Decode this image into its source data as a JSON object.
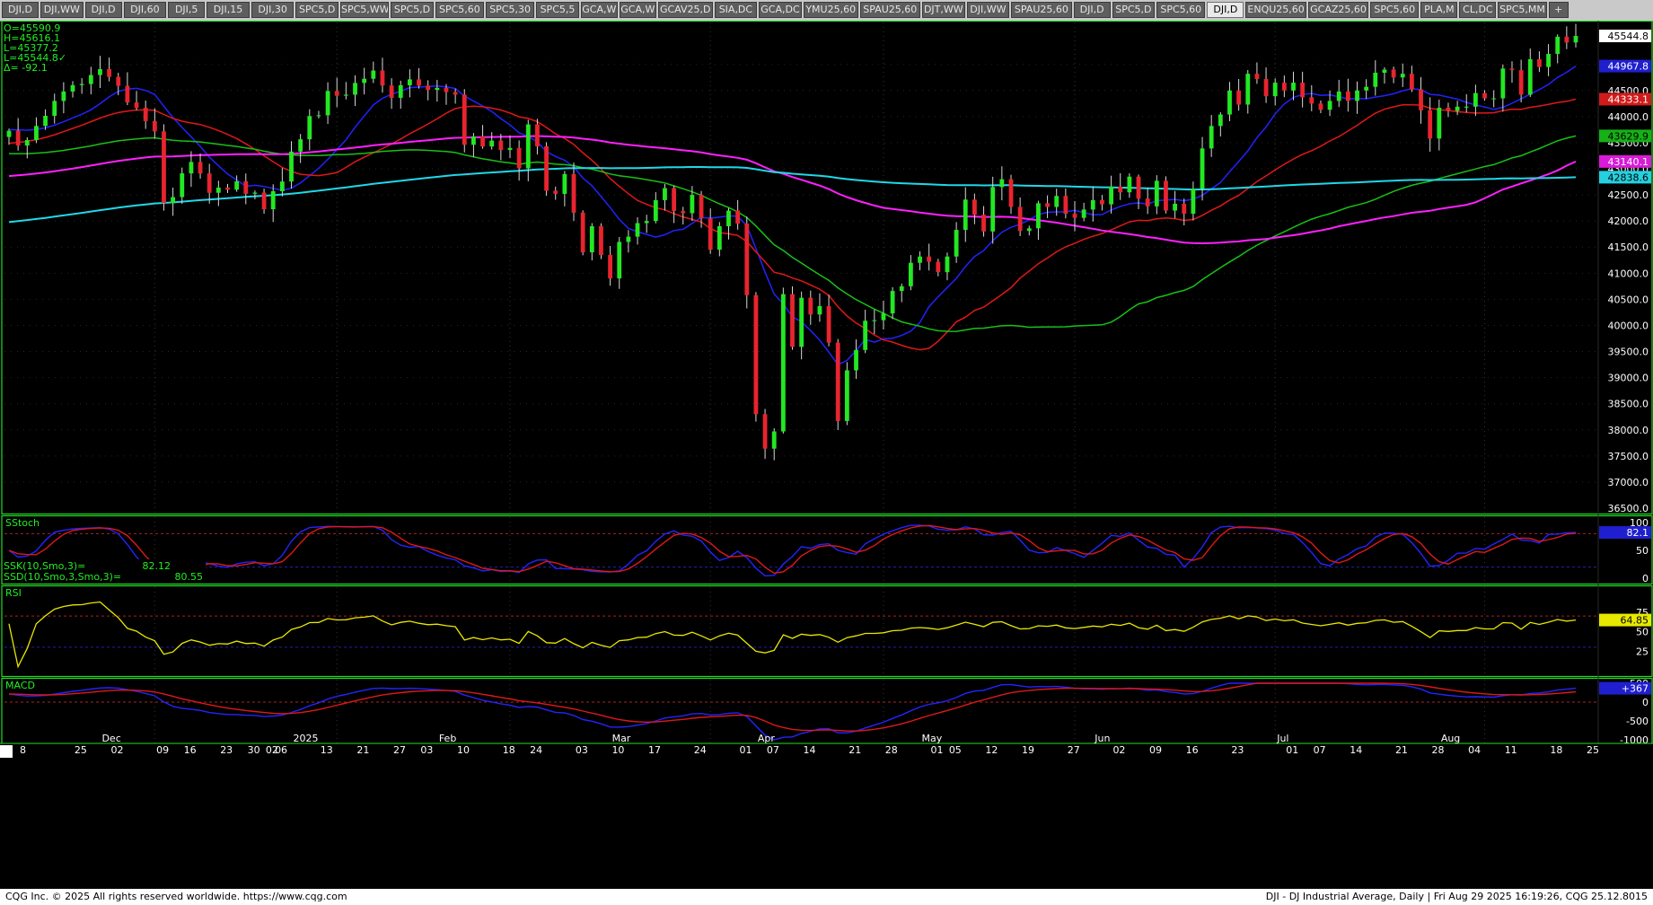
{
  "tabs": [
    "DJI,D",
    "DJI,WW",
    "DJI,D",
    "DJI,60",
    "DJI,5",
    "DJI,15",
    "DJI,30",
    "SPC5,D",
    "SPC5,WW",
    "SPC5,D",
    "SPC5,60",
    "SPC5,30",
    "SPC5,5",
    "GCA,W",
    "GCA,W",
    "GCAV25,D",
    "SIA,DC",
    "GCA,DC",
    "YMU25,60",
    "SPAU25,60",
    "DJT,WW",
    "DJI,WW",
    "SPAU25,60",
    "DJI,D",
    "SPC5,D",
    "SPC5,60",
    "DJI,D",
    "ENQU25,60",
    "GCAZ25,60",
    "SPC5,60",
    "PLA,M",
    "CL,DC",
    "SPC5,MM",
    "+"
  ],
  "active_tab_index": 26,
  "ohlc": {
    "open": "O=45590.9",
    "high": "H=45616.1",
    "low1": "L=45377.2",
    "low2": "L=45544.8✓",
    "delta": "Δ=  -92.1"
  },
  "price_axis": {
    "labels": [
      "45000.0",
      "44500.0",
      "44000.0",
      "43500.0",
      "43000.0",
      "42500.0",
      "42000.0",
      "41500.0",
      "41000.0",
      "40500.0",
      "40000.0",
      "39500.0",
      "39000.0",
      "38500.0",
      "38000.0",
      "37500.0",
      "37000.0",
      "36500.0"
    ],
    "badges": [
      {
        "label": "45544.8",
        "color": "#ffffff",
        "text_color": "#000000"
      },
      {
        "label": "44967.8",
        "color": "#1f1fd0",
        "text_color": "#ffffff"
      },
      {
        "label": "44333.1",
        "color": "#d01b1b",
        "text_color": "#ffffff"
      },
      {
        "label": "43629.9",
        "color": "#17b017",
        "text_color": "#000000"
      },
      {
        "label": "43140.1",
        "color": "#d81bd8",
        "text_color": "#ffffff"
      },
      {
        "label": "42838.6",
        "color": "#25d0e0",
        "text_color": "#000000"
      }
    ]
  },
  "stoch": {
    "title": "SStoch",
    "ssk_label": "SSK(10,Smo,3)=",
    "ssk_value": "82.12",
    "ssd_label": "SSD(10,Smo,3,Smo,3)=",
    "ssd_value": "80.55",
    "axis": [
      "100",
      "50",
      "0"
    ],
    "badge": "82.1"
  },
  "rsi": {
    "title": "RSI",
    "axis": [
      "75",
      "50",
      "25"
    ],
    "badge": "64.85"
  },
  "macd": {
    "title": "MACD",
    "axis": [
      "500",
      "0",
      "-500",
      "-1000"
    ],
    "badge": "+367"
  },
  "time_axis": {
    "days": [
      "8",
      "25",
      "02",
      "09",
      "16",
      "23",
      "30",
      "02",
      "06",
      "13",
      "21",
      "27",
      "03",
      "10",
      "18",
      "24",
      "03",
      "10",
      "17",
      "24",
      "01",
      "07",
      "14",
      "21",
      "28",
      "01",
      "05",
      "12",
      "19",
      "27",
      "02",
      "09",
      "16",
      "23",
      "01",
      "07",
      "14",
      "21",
      "28",
      "04",
      "11",
      "18",
      "25"
    ],
    "months": [
      "Dec",
      "2025",
      "Feb",
      "Mar",
      "Apr",
      "May",
      "Jun",
      "Jul",
      "Aug"
    ]
  },
  "colors": {
    "candle_up": "#22e822",
    "candle_down": "#e8242f",
    "ma1": "#2222ff",
    "ma2": "#e01818",
    "ma3": "#18c018",
    "ma4": "#ff20ff",
    "ma5": "#20d8e8",
    "stoch_k": "#2424ff",
    "stoch_d": "#e01818",
    "rsi": "#e8e800",
    "panel_border": "#22dd22"
  },
  "chart_data": {
    "type": "candlestick",
    "x_start": "2024-11-08",
    "x_end": "2025-08-29",
    "closes": [
      43729,
      43445,
      43550,
      43821,
      44015,
      44300,
      44480,
      44603,
      44624,
      44796,
      44909,
      44760,
      44590,
      44270,
      44170,
      43914,
      43717,
      42342,
      42458,
      42913,
      43130,
      42910,
      42541,
      42640,
      42600,
      42761,
      42522,
      42544,
      42226,
      42571,
      42756,
      43330,
      43565,
      44010,
      44025,
      44490,
      44400,
      44420,
      44645,
      44725,
      44882,
      44595,
      44360,
      44600,
      44713,
      44594,
      44510,
      44550,
      44470,
      44420,
      43460,
      43621,
      43428,
      43540,
      43360,
      43400,
      43010,
      43850,
      43430,
      42580,
      42520,
      42900,
      42160,
      41400,
      41900,
      41350,
      40900,
      41600,
      41700,
      41960,
      42000,
      42400,
      42630,
      42190,
      42150,
      42500,
      42050,
      41450,
      41900,
      42200,
      41950,
      40580,
      38300,
      37640,
      37970,
      40600,
      39590,
      40530,
      40210,
      40370,
      39670,
      38170,
      39140,
      39530,
      40090,
      40100,
      40230,
      40660,
      40750,
      41200,
      41320,
      41220,
      41020,
      41320,
      41830,
      42410,
      42120,
      41800,
      42650,
      42800,
      42270,
      41810,
      41860,
      42340,
      42270,
      42480,
      42140,
      42060,
      42220,
      42400,
      42320,
      42660,
      42550,
      42850,
      42430,
      42280,
      42770,
      42200,
      42330,
      42140,
      42620,
      43390,
      43820,
      44040,
      44500,
      44230,
      44820,
      44720,
      44390,
      44650,
      44500,
      44650,
      44370,
      44250,
      44130,
      44300,
      44480,
      44300,
      44500,
      44570,
      44840,
      44900,
      44750,
      44820,
      44520,
      44120,
      43580,
      44170,
      44110,
      44190,
      44190,
      44450,
      44350,
      44350,
      44920,
      44890,
      44420,
      45100,
      44950,
      45200,
      45530,
      45420,
      45545
    ],
    "ma_series": [
      {
        "period": 10,
        "last": 44967.8
      },
      {
        "period": 20,
        "last": 44333.1
      },
      {
        "period": 40,
        "last": 43629.9
      },
      {
        "period": 80,
        "last": 43140.1
      },
      {
        "period": 160,
        "last": 42838.6
      }
    ],
    "price_ylim": [
      36500,
      45700
    ],
    "stoch": {
      "ssk": 82.12,
      "ssd": 80.55,
      "ylim": [
        0,
        100
      ]
    },
    "rsi": {
      "last": 64.85,
      "ylim": [
        0,
        100
      ]
    },
    "macd": {
      "last": 367,
      "ylim": [
        -1000,
        500
      ]
    }
  },
  "footer": {
    "left": "CQG Inc. © 2025 All rights reserved worldwide. https://www.cqg.com",
    "right": "DJI - DJ Industrial Average, Daily | Fri Aug 29 2025 16:19:26, CQG 25.12.8015"
  }
}
